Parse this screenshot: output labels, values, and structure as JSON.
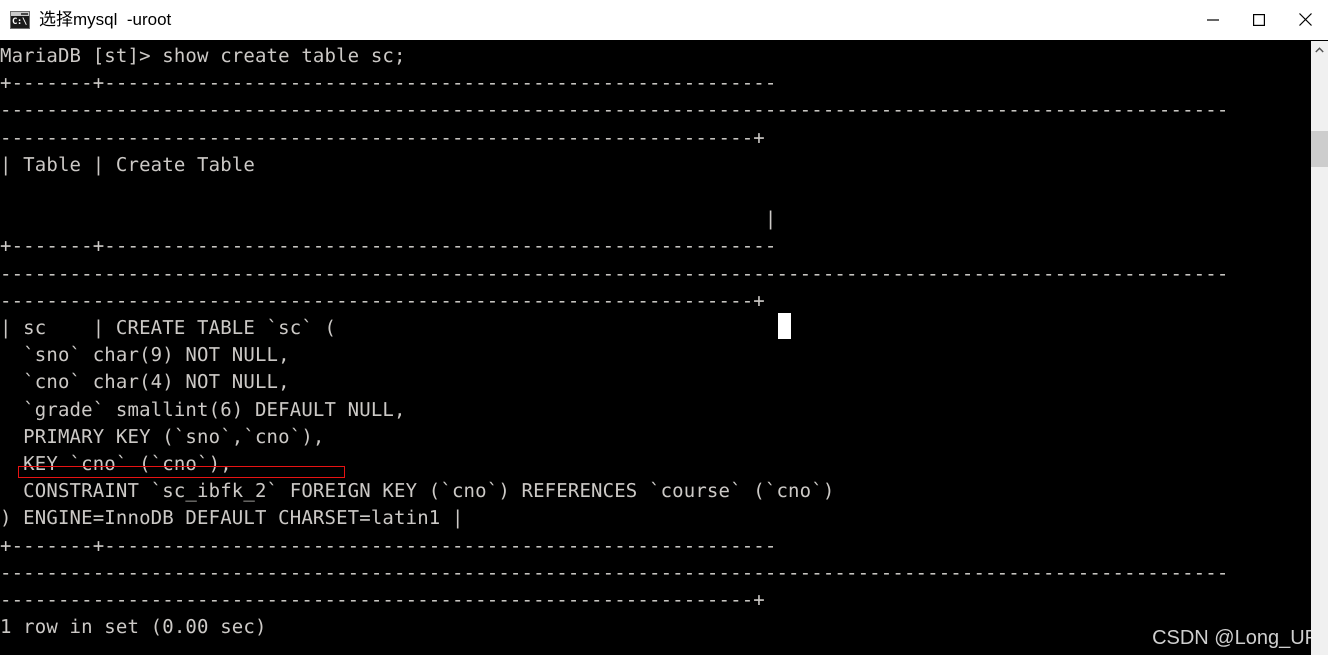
{
  "window": {
    "title": "选择mysql  -uroot",
    "icon_name": "cmd-console-icon",
    "icon_text": "C:\\",
    "controls": {
      "minimize_label": "Minimize",
      "maximize_label": "Maximize",
      "close_label": "Close"
    }
  },
  "terminal": {
    "prompt_line": "MariaDB [st]> show create table sc;",
    "foreground_color": "#ccc9c6",
    "background_color": "#000000",
    "lines": [
      "MariaDB [st]> show create table sc;",
      "+-------+----------------------------------------------------------",
      "----------------------------------------------------------------------------------------------------------",
      "-----------------------------------------------------------------+",
      "| Table | Create Table",
      "",
      "                                                                  |",
      "+-------+----------------------------------------------------------",
      "----------------------------------------------------------------------------------------------------------",
      "-----------------------------------------------------------------+",
      "| sc    | CREATE TABLE `sc` (",
      "  `sno` char(9) NOT NULL,",
      "  `cno` char(4) NOT NULL,",
      "  `grade` smallint(6) DEFAULT NULL,",
      "  PRIMARY KEY (`sno`,`cno`),",
      "  KEY `cno` (`cno`),",
      "  CONSTRAINT `sc_ibfk_2` FOREIGN KEY (`cno`) REFERENCES `course` (`cno`)",
      ") ENGINE=InnoDB DEFAULT CHARSET=latin1 |",
      "+-------+----------------------------------------------------------",
      "----------------------------------------------------------------------------------------------------------",
      "-----------------------------------------------------------------+",
      "1 row in set (0.00 sec)"
    ],
    "cursor": {
      "visible": true,
      "color": "#ffffff"
    }
  },
  "annotation": {
    "type": "rectangle-highlight",
    "color": "#e81313",
    "targets_line": "  KEY `cno` (`cno`),"
  },
  "watermark": {
    "text": "CSDN @Long_UP",
    "color": "#cfcfcf"
  },
  "scrollbar": {
    "up_arrow_label": "Scroll up",
    "thumb_label": "Scroll thumb",
    "track_label": "Scroll track"
  }
}
